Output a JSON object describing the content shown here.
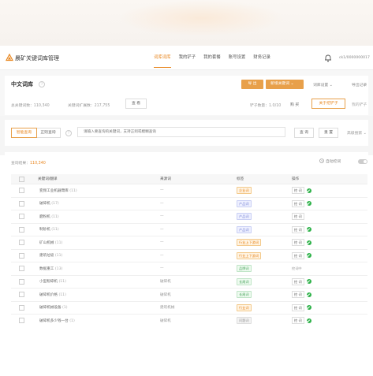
{
  "app": {
    "title": "晨矿关键词库管理"
  },
  "nav": {
    "items": [
      {
        "label": "词库词库",
        "active": true
      },
      {
        "label": "我的铲子",
        "active": false
      },
      {
        "label": "我的套餐",
        "active": false
      },
      {
        "label": "账号设置",
        "active": false
      },
      {
        "label": "财务记录",
        "active": false
      }
    ]
  },
  "user": {
    "name": "ck1/0000000017"
  },
  "page": {
    "title": "中文词库",
    "export_label": "导 出",
    "add_label": "新增关键词 ⌄",
    "settings_label": "词库设置 ⌄",
    "records_label": "导出记录",
    "stat_total": "总关键词数：110,340",
    "stat_extended": "关键词扩展数：217,755",
    "view_label": "查 看",
    "shovel_count": "铲子数量：1.0/10",
    "purchase_label": "购 买",
    "about_label": "关于挖铲子",
    "recharge_label": "我的铲子"
  },
  "search": {
    "mode_smart": "智能查询",
    "mode_regex": "正则查询",
    "placeholder": "请输入要查询的关键词，支持正则或模糊查询",
    "query_label": "查 询",
    "reset_label": "重 置",
    "advanced_label": "高级搜索 ⌄"
  },
  "results": {
    "label": "查询结果：",
    "count": "110,340",
    "auto_label": "自动挖词"
  },
  "table": {
    "headers": [
      "关键词/翻译",
      "来源词",
      "标签",
      "操作"
    ],
    "rows": [
      {
        "keyword": "变频工业机器臂库",
        "count": "(11)",
        "source": "—",
        "tag": "企业词",
        "tag_color": "orange",
        "actions": [
          "挖 词"
        ],
        "ok": true
      },
      {
        "keyword": "破碎机",
        "count": "(17)",
        "source": "—",
        "tag": "产品词",
        "tag_color": "blue",
        "actions": [
          "挖 词"
        ],
        "ok": true
      },
      {
        "keyword": "磨粉机",
        "count": "(11)",
        "source": "—",
        "tag": "产品词",
        "tag_color": "blue",
        "actions": [
          "挖 词"
        ],
        "ok": false
      },
      {
        "keyword": "制砂机",
        "count": "(11)",
        "source": "—",
        "tag": "产品词",
        "tag_color": "blue",
        "actions": [
          "挖 词"
        ],
        "ok": true
      },
      {
        "keyword": "矿山机械",
        "count": "(11)",
        "source": "—",
        "tag": "行业上下游词",
        "tag_color": "orange",
        "actions": [
          "挖 词"
        ],
        "ok": true
      },
      {
        "keyword": "建筑垃圾",
        "count": "(11)",
        "source": "—",
        "tag": "行业上下游词",
        "tag_color": "orange",
        "actions": [
          "挖 词"
        ],
        "ok": true
      },
      {
        "keyword": "数据重工",
        "count": "(13)",
        "source": "—",
        "tag": "品牌词",
        "tag_color": "green",
        "actions": [
          "挖词中"
        ],
        "ok": false
      },
      {
        "keyword": "小型粉碎机",
        "count": "(11)",
        "source": "破碎机",
        "tag": "长尾词",
        "tag_color": "green",
        "actions": [
          "挖 词"
        ],
        "ok": true
      },
      {
        "keyword": "破碎机价格",
        "count": "(11)",
        "source": "破碎机",
        "tag": "长尾词",
        "tag_color": "green",
        "actions": [
          "挖 词"
        ],
        "ok": true
      },
      {
        "keyword": "破碎机械设备",
        "count": "(1)",
        "source": "建筑机械",
        "tag": "行业词",
        "tag_color": "orange",
        "actions": [
          "挖 词"
        ],
        "ok": true
      },
      {
        "keyword": "破碎机多少钱一台",
        "count": "(1)",
        "source": "破碎机",
        "tag": "问题词",
        "tag_color": "gray",
        "actions": [
          "挖 词"
        ],
        "ok": true
      }
    ]
  }
}
